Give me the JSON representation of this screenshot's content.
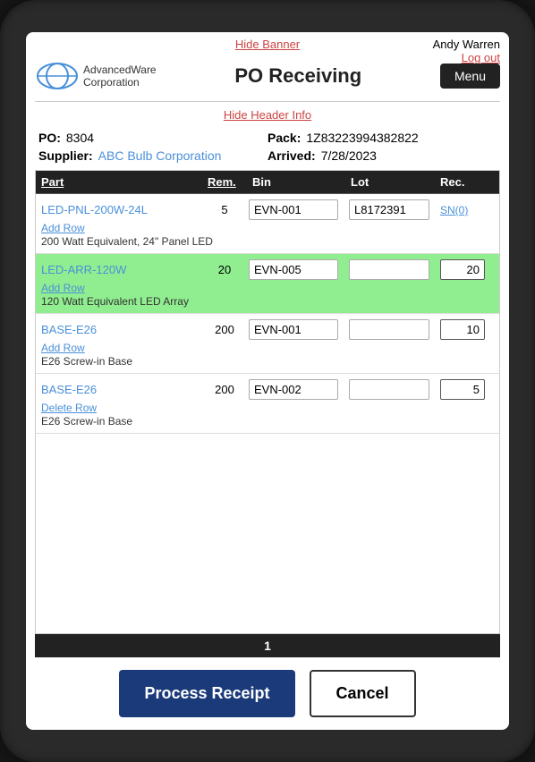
{
  "banner": {
    "hide_banner_label": "Hide Banner"
  },
  "user": {
    "name": "Andy Warren",
    "logout_label": "Log out"
  },
  "header": {
    "title": "PO Receiving",
    "menu_label": "Menu",
    "hide_header_label": "Hide Header Info"
  },
  "po_info": {
    "po_label": "PO:",
    "po_value": "8304",
    "pack_label": "Pack:",
    "pack_value": "1Z83223994382822",
    "supplier_label": "Supplier:",
    "supplier_value": "ABC Bulb Corporation",
    "arrived_label": "Arrived:",
    "arrived_value": "7/28/2023"
  },
  "table": {
    "columns": {
      "part": "Part",
      "rem": "Rem.",
      "bin": "Bin",
      "lot": "Lot",
      "rec": "Rec."
    },
    "rows": [
      {
        "part": "LED-PNL-200W-24L",
        "rem": "5",
        "bin": "EVN-001",
        "lot": "L8172391",
        "rec": "",
        "sn_label": "SN(0)",
        "add_row_label": "Add Row",
        "delete_row_label": null,
        "desc": "200 Watt Equivalent, 24\" Panel LED",
        "highlighted": false
      },
      {
        "part": "LED-ARR-120W",
        "rem": "20",
        "bin": "EVN-005",
        "lot": "",
        "rec": "20",
        "sn_label": null,
        "add_row_label": "Add Row",
        "delete_row_label": null,
        "desc": "120 Watt Equivalent LED Array",
        "highlighted": true
      },
      {
        "part": "BASE-E26",
        "rem": "200",
        "bin": "EVN-001",
        "lot": "",
        "rec": "10",
        "sn_label": null,
        "add_row_label": "Add Row",
        "delete_row_label": null,
        "desc": "E26 Screw-in Base",
        "highlighted": false
      },
      {
        "part": "BASE-E26",
        "rem": "200",
        "bin": "EVN-002",
        "lot": "",
        "rec": "5",
        "sn_label": null,
        "add_row_label": null,
        "delete_row_label": "Delete Row",
        "desc": "E26 Screw-in Base",
        "highlighted": false
      }
    ]
  },
  "pagination": {
    "page": "1"
  },
  "actions": {
    "process_label": "Process Receipt",
    "cancel_label": "Cancel"
  },
  "logo": {
    "line1": "dvancedWare",
    "line2": "orporation"
  }
}
